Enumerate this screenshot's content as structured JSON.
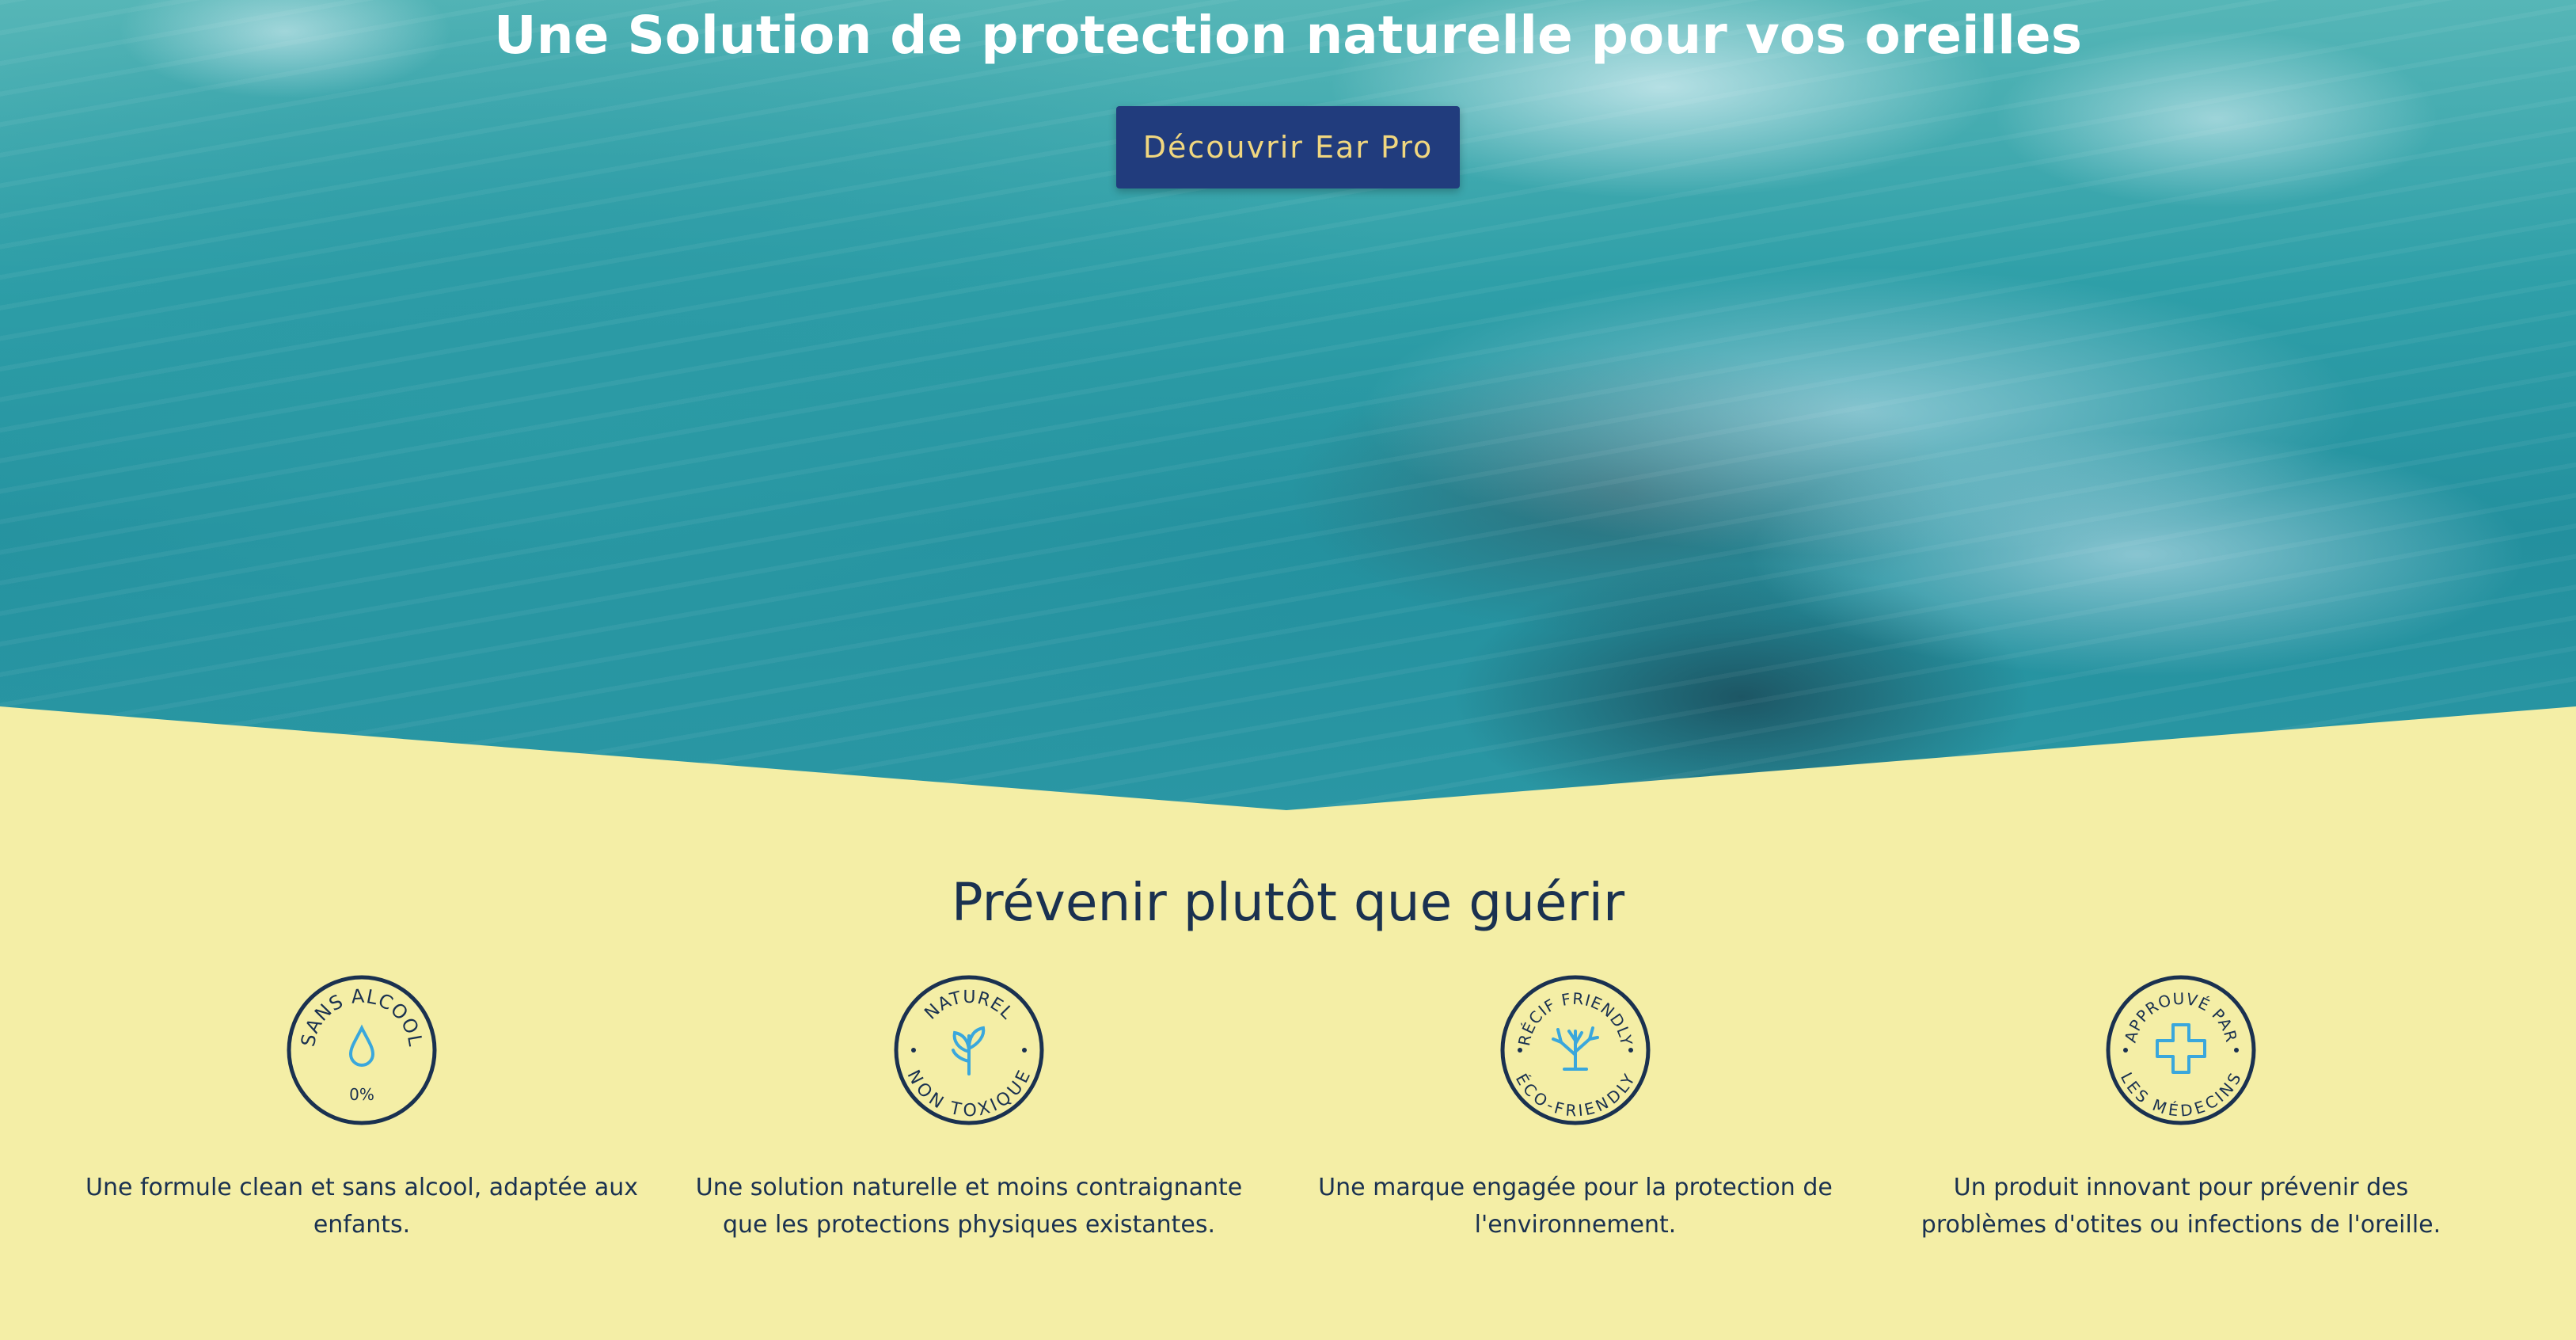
{
  "hero": {
    "title": "Une Solution de protection naturelle pour vos oreilles",
    "cta_label": "Découvrir Ear Pro"
  },
  "section": {
    "title": "Prévenir plutôt que guérir"
  },
  "features": [
    {
      "badge_top": "SANS ALCOOL",
      "badge_bottom": "0%",
      "icon": "drop-icon",
      "text": "Une formule clean et sans alcool, adaptée aux enfants."
    },
    {
      "badge_top": "NATUREL",
      "badge_bottom": "NON TOXIQUE",
      "icon": "plant-icon",
      "text": "Une solution naturelle et moins contraignante que les protections physiques existantes."
    },
    {
      "badge_top": "RÉCIF FRIENDLY",
      "badge_bottom": "ÉCO-FRIENDLY",
      "icon": "coral-icon",
      "text": "Une marque engagée pour la protection de l'environnement."
    },
    {
      "badge_top": "APPROUVÉ PAR",
      "badge_bottom": "LES MÉDECINS",
      "icon": "medical-cross-icon",
      "text": "Un produit innovant pour prévenir des problèmes d'otites ou infections de l'oreille."
    }
  ],
  "colors": {
    "background": "#f4eea6",
    "navy": "#1a3150",
    "button": "#213c7d",
    "button_text": "#f1d77f",
    "accent_blue": "#3aa7dc"
  }
}
